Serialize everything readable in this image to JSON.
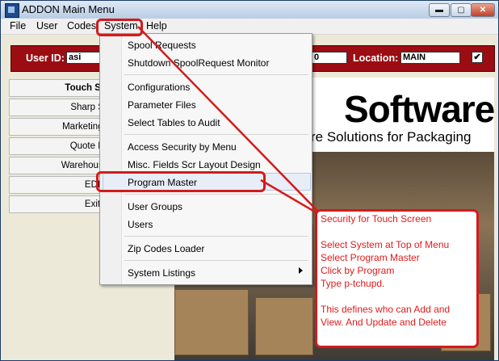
{
  "window": {
    "title": "ADDON Main Menu",
    "minimize": "▬",
    "maximize": "▢",
    "close": "✕"
  },
  "menubar": {
    "file": "File",
    "user": "User",
    "codes": "Codes",
    "system": "System",
    "help": "Help"
  },
  "userbar": {
    "user_id_label": "User ID:",
    "user_id_value": "asi",
    "partial_value": "0",
    "location_label": "Location:",
    "location_value": "MAIN",
    "checkbox_mark": "✔"
  },
  "nav_buttons": [
    "Touch Scree",
    "Sharp Sho",
    "Marketing Con",
    "Quote Req",
    "Warehouse Ma",
    "EDI",
    "Exit"
  ],
  "partial_button_suffix": "e",
  "logo": {
    "word": "Software",
    "tagline": "re Solutions for Packaging"
  },
  "system_menu": {
    "group1": [
      "Spool Requests",
      "Shutdown SpoolRequest Monitor"
    ],
    "group2": [
      "Configurations",
      "Parameter Files",
      "Select Tables to Audit"
    ],
    "group3": [
      "Access Security by Menu",
      "Misc. Fields Scr Layout Design",
      "Program Master"
    ],
    "group4": [
      "User Groups",
      "Users"
    ],
    "group5": [
      "Zip Codes Loader"
    ],
    "group6": [
      "System Listings"
    ],
    "submenu_arrow_icon": "triangle-right"
  },
  "callout": {
    "lines": [
      "Security for Touch Screen",
      "",
      "Select System at Top of Menu",
      "Select Program Master",
      "Click by Program",
      "Type p-tchupd.",
      "",
      "This defines who can Add and",
      "View.  And Update and Delete"
    ]
  },
  "colors": {
    "user_bar": "#9b0d12",
    "annotation": "#d31b1b",
    "highlight": "#e8eef8"
  }
}
